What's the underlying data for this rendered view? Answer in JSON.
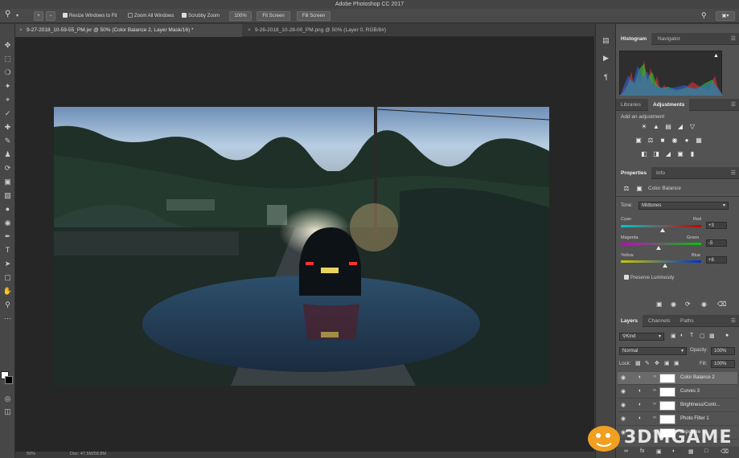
{
  "app": {
    "title": "Adobe Photoshop CC 2017"
  },
  "options": {
    "resize_windows": "Resize Windows to Fit",
    "zoom_all": "Zoom All Windows",
    "scrubby_zoom": "Scrubby Zoom",
    "zoom_value": "100%",
    "fit_screen": "Fit Screen",
    "fill_screen": "Fill Screen"
  },
  "tabs": [
    {
      "label": "9-27-2018_10-59-55_PM.jxr @ 50% (Color Balance 2, Layer Mask/16) *",
      "close": "×"
    },
    {
      "label": "9-26-2018_10-28-00_PM.png @ 50% (Layer 0, RGB/8#)",
      "close": "×"
    }
  ],
  "status": {
    "zoom": "50%",
    "doc": "Doc: 47.5M/58.8M"
  },
  "histogram": {
    "tabs": [
      "Histogram",
      "Navigator"
    ]
  },
  "adjustments": {
    "tabs": [
      "Libraries",
      "Adjustments"
    ],
    "heading": "Add an adjustment"
  },
  "properties": {
    "tabs": [
      "Properties",
      "Info"
    ],
    "title": "Color Balance",
    "tone_label": "Tone:",
    "tone_value": "Midtones",
    "sliders": [
      {
        "left": "Cyan",
        "right": "Red",
        "value": "+3",
        "position": 0.52
      },
      {
        "left": "Magenta",
        "right": "Green",
        "value": "-5",
        "position": 0.47
      },
      {
        "left": "Yellow",
        "right": "Blue",
        "value": "+8",
        "position": 0.55
      }
    ],
    "preserve": "Preserve Luminosity"
  },
  "layers": {
    "tabs": [
      "Layers",
      "Channels",
      "Paths"
    ],
    "filter": "Kind",
    "blend": "Normal",
    "opacity_label": "Opacity:",
    "opacity": "100%",
    "lock_label": "Lock:",
    "fill_label": "Fill:",
    "fill": "100%",
    "items": [
      {
        "name": "Color Balance 2"
      },
      {
        "name": "Curves 3"
      },
      {
        "name": "Brightness/Contr..."
      },
      {
        "name": "Photo Filter 1"
      },
      {
        "name": "Exposure 1"
      }
    ]
  },
  "watermark": {
    "text": "3DMGAME"
  },
  "colors": {
    "panel_bg": "#535353",
    "canvas_bg": "#262626",
    "accent": "#f0a020"
  }
}
